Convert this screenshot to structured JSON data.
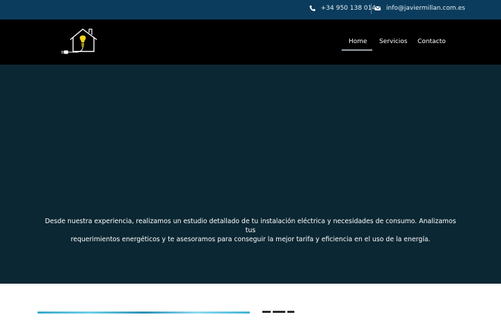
{
  "topbar": {
    "phone": "+34 950 138 014",
    "email": "info@javiermillan.com.es",
    "icons": {
      "phone": "phone-icon",
      "email": "envelope-icon"
    }
  },
  "nav": {
    "logo": "house-bulb-plug-logo",
    "items": [
      {
        "label": "Home",
        "active": true
      },
      {
        "label": "Servicios",
        "active": false
      },
      {
        "label": "Contacto",
        "active": false
      }
    ]
  },
  "hero": {
    "text_line1": "Desde nuestra experiencia, realizamos un estudio detallado de tu instalación eléctrica y necesidades de consumo. Analizamos tus",
    "text_line2": "requerimientos energéticos y te asesoramos para conseguir la mejor tarifa y eficiencia en el uso de la energía."
  },
  "colors": {
    "topbar": "#0b3c5d",
    "navbar": "#000000",
    "hero": "#0b2733",
    "accent_bulb": "#f2d21a"
  }
}
